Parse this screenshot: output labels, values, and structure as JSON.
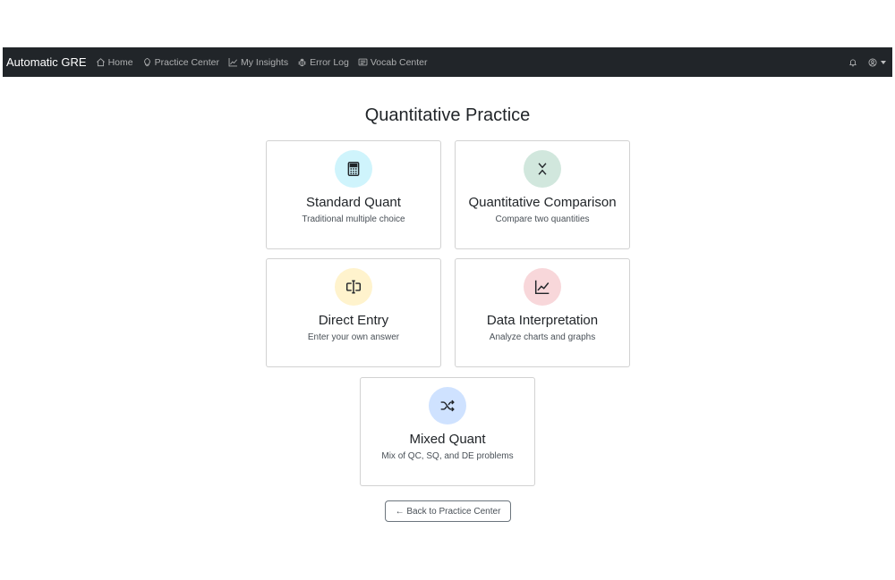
{
  "navbar": {
    "brand": "Automatic GRE",
    "links": [
      {
        "label": "Home",
        "icon": "house-icon"
      },
      {
        "label": "Practice Center",
        "icon": "lightbulb-icon"
      },
      {
        "label": "My Insights",
        "icon": "graph-up-icon"
      },
      {
        "label": "Error Log",
        "icon": "bug-icon"
      },
      {
        "label": "Vocab Center",
        "icon": "card-text-icon"
      }
    ],
    "right_icons": [
      "bell-icon",
      "person-circle-icon",
      "caret-down-icon"
    ]
  },
  "page": {
    "title": "Quantitative Practice"
  },
  "cards": [
    {
      "title": "Standard Quant",
      "description": "Traditional multiple choice",
      "icon": "calculator-icon",
      "color": "#cff4fc"
    },
    {
      "title": "Quantitative Comparison",
      "description": "Compare two quantities",
      "icon": "arrows-collapse-icon",
      "color": "#d1e7dd"
    },
    {
      "title": "Direct Entry",
      "description": "Enter your own answer",
      "icon": "input-cursor-icon",
      "color": "#fff3cd"
    },
    {
      "title": "Data Interpretation",
      "description": "Analyze charts and graphs",
      "icon": "graph-up-icon",
      "color": "#f8d7da"
    },
    {
      "title": "Mixed Quant",
      "description": "Mix of QC, SQ, and DE problems",
      "icon": "shuffle-icon",
      "color": "#cfe2ff"
    }
  ],
  "back_button": {
    "label": "← Back to Practice Center"
  }
}
